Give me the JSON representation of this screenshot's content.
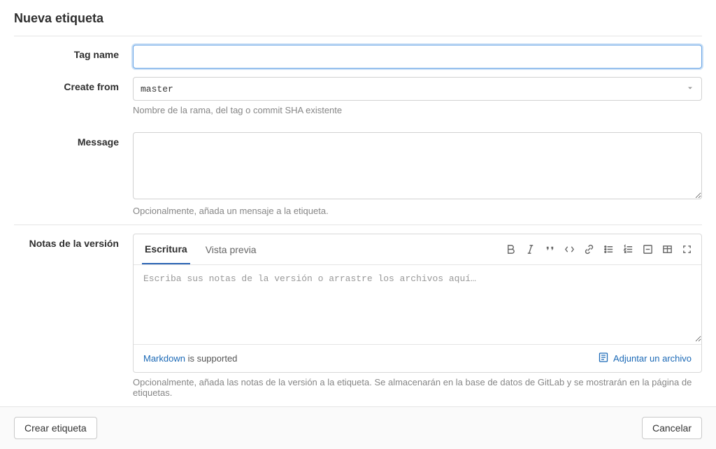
{
  "page": {
    "title": "Nueva etiqueta"
  },
  "form": {
    "tag_name": {
      "label": "Tag name",
      "value": ""
    },
    "create_from": {
      "label": "Create from",
      "value": "master",
      "help": "Nombre de la rama, del tag o commit SHA existente"
    },
    "message": {
      "label": "Message",
      "value": "",
      "help": "Opcionalmente, añada un mensaje a la etiqueta."
    },
    "release_notes": {
      "label": "Notas de la versión",
      "tabs": {
        "write": "Escritura",
        "preview": "Vista previa"
      },
      "placeholder": "Escriba sus notas de la versión o arrastre los archivos aquí…",
      "markdown_link": "Markdown",
      "markdown_supported": " is supported",
      "attach_file": "Adjuntar un archivo",
      "help": "Opcionalmente, añada las notas de la versión a la etiqueta. Se almacenarán en la base de datos de GitLab y se mostrarán en la página de etiquetas."
    }
  },
  "actions": {
    "create": "Crear etiqueta",
    "cancel": "Cancelar"
  }
}
